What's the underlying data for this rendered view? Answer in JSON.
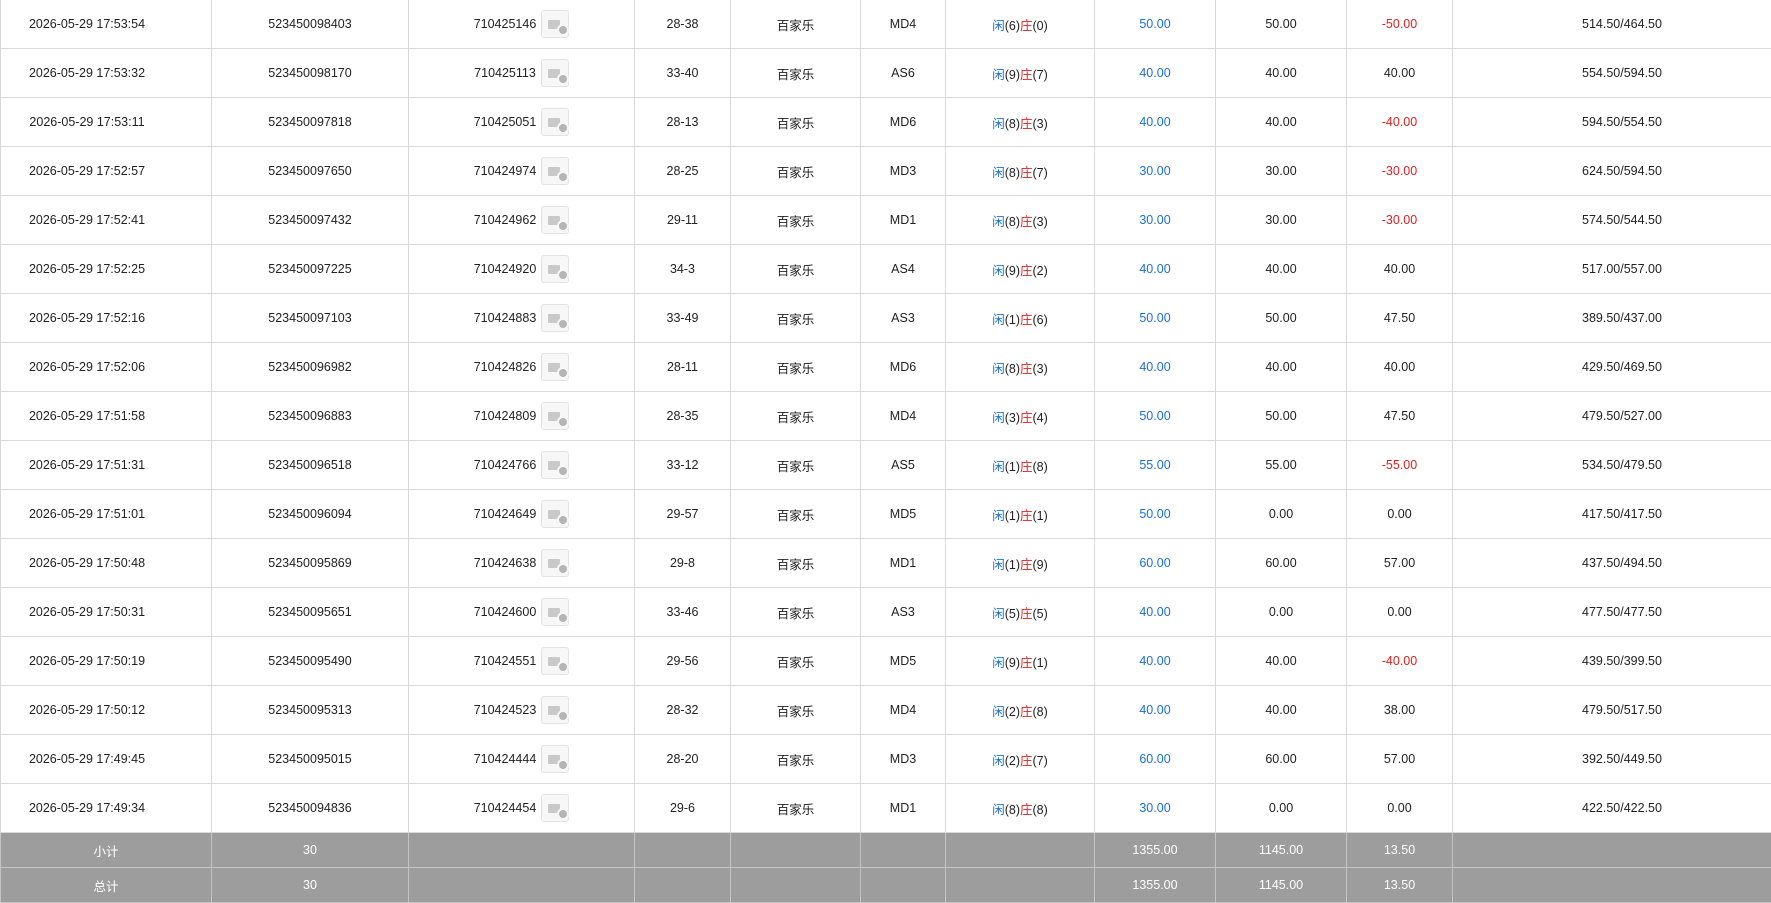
{
  "colors": {
    "player": "#1a6fd6",
    "banker": "#e02020",
    "summary_bg": "#9d9d9d"
  },
  "icons": {
    "detail": "detail-icon"
  },
  "rows": [
    {
      "time": "2026-05-29 17:53:54",
      "order": "523450098403",
      "game": "710425146",
      "shoe": "28-38",
      "type": "百家乐",
      "table": "MD4",
      "p_label": "闲",
      "p_val": "(6)",
      "b_label": "庄",
      "b_val": "(0)",
      "bet": "50.00",
      "valid": "50.00",
      "win": "-50.00",
      "win_neg": true,
      "balance": "514.50/464.50"
    },
    {
      "time": "2026-05-29 17:53:32",
      "order": "523450098170",
      "game": "710425113",
      "shoe": "33-40",
      "type": "百家乐",
      "table": "AS6",
      "p_label": "闲",
      "p_val": "(9)",
      "b_label": "庄",
      "b_val": "(7)",
      "bet": "40.00",
      "valid": "40.00",
      "win": "40.00",
      "win_neg": false,
      "balance": "554.50/594.50"
    },
    {
      "time": "2026-05-29 17:53:11",
      "order": "523450097818",
      "game": "710425051",
      "shoe": "28-13",
      "type": "百家乐",
      "table": "MD6",
      "p_label": "闲",
      "p_val": "(8)",
      "b_label": "庄",
      "b_val": "(3)",
      "bet": "40.00",
      "valid": "40.00",
      "win": "-40.00",
      "win_neg": true,
      "balance": "594.50/554.50"
    },
    {
      "time": "2026-05-29 17:52:57",
      "order": "523450097650",
      "game": "710424974",
      "shoe": "28-25",
      "type": "百家乐",
      "table": "MD3",
      "p_label": "闲",
      "p_val": "(8)",
      "b_label": "庄",
      "b_val": "(7)",
      "bet": "30.00",
      "valid": "30.00",
      "win": "-30.00",
      "win_neg": true,
      "balance": "624.50/594.50"
    },
    {
      "time": "2026-05-29 17:52:41",
      "order": "523450097432",
      "game": "710424962",
      "shoe": "29-11",
      "type": "百家乐",
      "table": "MD1",
      "p_label": "闲",
      "p_val": "(8)",
      "b_label": "庄",
      "b_val": "(3)",
      "bet": "30.00",
      "valid": "30.00",
      "win": "-30.00",
      "win_neg": true,
      "balance": "574.50/544.50"
    },
    {
      "time": "2026-05-29 17:52:25",
      "order": "523450097225",
      "game": "710424920",
      "shoe": "34-3",
      "type": "百家乐",
      "table": "AS4",
      "p_label": "闲",
      "p_val": "(9)",
      "b_label": "庄",
      "b_val": "(2)",
      "bet": "40.00",
      "valid": "40.00",
      "win": "40.00",
      "win_neg": false,
      "balance": "517.00/557.00"
    },
    {
      "time": "2026-05-29 17:52:16",
      "order": "523450097103",
      "game": "710424883",
      "shoe": "33-49",
      "type": "百家乐",
      "table": "AS3",
      "p_label": "闲",
      "p_val": "(1)",
      "b_label": "庄",
      "b_val": "(6)",
      "bet": "50.00",
      "valid": "50.00",
      "win": "47.50",
      "win_neg": false,
      "balance": "389.50/437.00"
    },
    {
      "time": "2026-05-29 17:52:06",
      "order": "523450096982",
      "game": "710424826",
      "shoe": "28-11",
      "type": "百家乐",
      "table": "MD6",
      "p_label": "闲",
      "p_val": "(8)",
      "b_label": "庄",
      "b_val": "(3)",
      "bet": "40.00",
      "valid": "40.00",
      "win": "40.00",
      "win_neg": false,
      "balance": "429.50/469.50"
    },
    {
      "time": "2026-05-29 17:51:58",
      "order": "523450096883",
      "game": "710424809",
      "shoe": "28-35",
      "type": "百家乐",
      "table": "MD4",
      "p_label": "闲",
      "p_val": "(3)",
      "b_label": "庄",
      "b_val": "(4)",
      "bet": "50.00",
      "valid": "50.00",
      "win": "47.50",
      "win_neg": false,
      "balance": "479.50/527.00"
    },
    {
      "time": "2026-05-29 17:51:31",
      "order": "523450096518",
      "game": "710424766",
      "shoe": "33-12",
      "type": "百家乐",
      "table": "AS5",
      "p_label": "闲",
      "p_val": "(1)",
      "b_label": "庄",
      "b_val": "(8)",
      "bet": "55.00",
      "valid": "55.00",
      "win": "-55.00",
      "win_neg": true,
      "balance": "534.50/479.50"
    },
    {
      "time": "2026-05-29 17:51:01",
      "order": "523450096094",
      "game": "710424649",
      "shoe": "29-57",
      "type": "百家乐",
      "table": "MD5",
      "p_label": "闲",
      "p_val": "(1)",
      "b_label": "庄",
      "b_val": "(1)",
      "bet": "50.00",
      "valid": "0.00",
      "win": "0.00",
      "win_neg": false,
      "balance": "417.50/417.50"
    },
    {
      "time": "2026-05-29 17:50:48",
      "order": "523450095869",
      "game": "710424638",
      "shoe": "29-8",
      "type": "百家乐",
      "table": "MD1",
      "p_label": "闲",
      "p_val": "(1)",
      "b_label": "庄",
      "b_val": "(9)",
      "bet": "60.00",
      "valid": "60.00",
      "win": "57.00",
      "win_neg": false,
      "balance": "437.50/494.50"
    },
    {
      "time": "2026-05-29 17:50:31",
      "order": "523450095651",
      "game": "710424600",
      "shoe": "33-46",
      "type": "百家乐",
      "table": "AS3",
      "p_label": "闲",
      "p_val": "(5)",
      "b_label": "庄",
      "b_val": "(5)",
      "bet": "40.00",
      "valid": "0.00",
      "win": "0.00",
      "win_neg": false,
      "balance": "477.50/477.50"
    },
    {
      "time": "2026-05-29 17:50:19",
      "order": "523450095490",
      "game": "710424551",
      "shoe": "29-56",
      "type": "百家乐",
      "table": "MD5",
      "p_label": "闲",
      "p_val": "(9)",
      "b_label": "庄",
      "b_val": "(1)",
      "bet": "40.00",
      "valid": "40.00",
      "win": "-40.00",
      "win_neg": true,
      "balance": "439.50/399.50"
    },
    {
      "time": "2026-05-29 17:50:12",
      "order": "523450095313",
      "game": "710424523",
      "shoe": "28-32",
      "type": "百家乐",
      "table": "MD4",
      "p_label": "闲",
      "p_val": "(2)",
      "b_label": "庄",
      "b_val": "(8)",
      "bet": "40.00",
      "valid": "40.00",
      "win": "38.00",
      "win_neg": false,
      "balance": "479.50/517.50"
    },
    {
      "time": "2026-05-29 17:49:45",
      "order": "523450095015",
      "game": "710424444",
      "shoe": "28-20",
      "type": "百家乐",
      "table": "MD3",
      "p_label": "闲",
      "p_val": "(2)",
      "b_label": "庄",
      "b_val": "(7)",
      "bet": "60.00",
      "valid": "60.00",
      "win": "57.00",
      "win_neg": false,
      "balance": "392.50/449.50"
    },
    {
      "time": "2026-05-29 17:49:34",
      "order": "523450094836",
      "game": "710424454",
      "shoe": "29-6",
      "type": "百家乐",
      "table": "MD1",
      "p_label": "闲",
      "p_val": "(8)",
      "b_label": "庄",
      "b_val": "(8)",
      "bet": "30.00",
      "valid": "0.00",
      "win": "0.00",
      "win_neg": false,
      "balance": "422.50/422.50"
    }
  ],
  "subtotal": {
    "label": "小计",
    "count": "30",
    "bet": "1355.00",
    "valid": "1145.00",
    "win": "13.50"
  },
  "total": {
    "label": "总计",
    "count": "30",
    "bet": "1355.00",
    "valid": "1145.00",
    "win": "13.50"
  }
}
